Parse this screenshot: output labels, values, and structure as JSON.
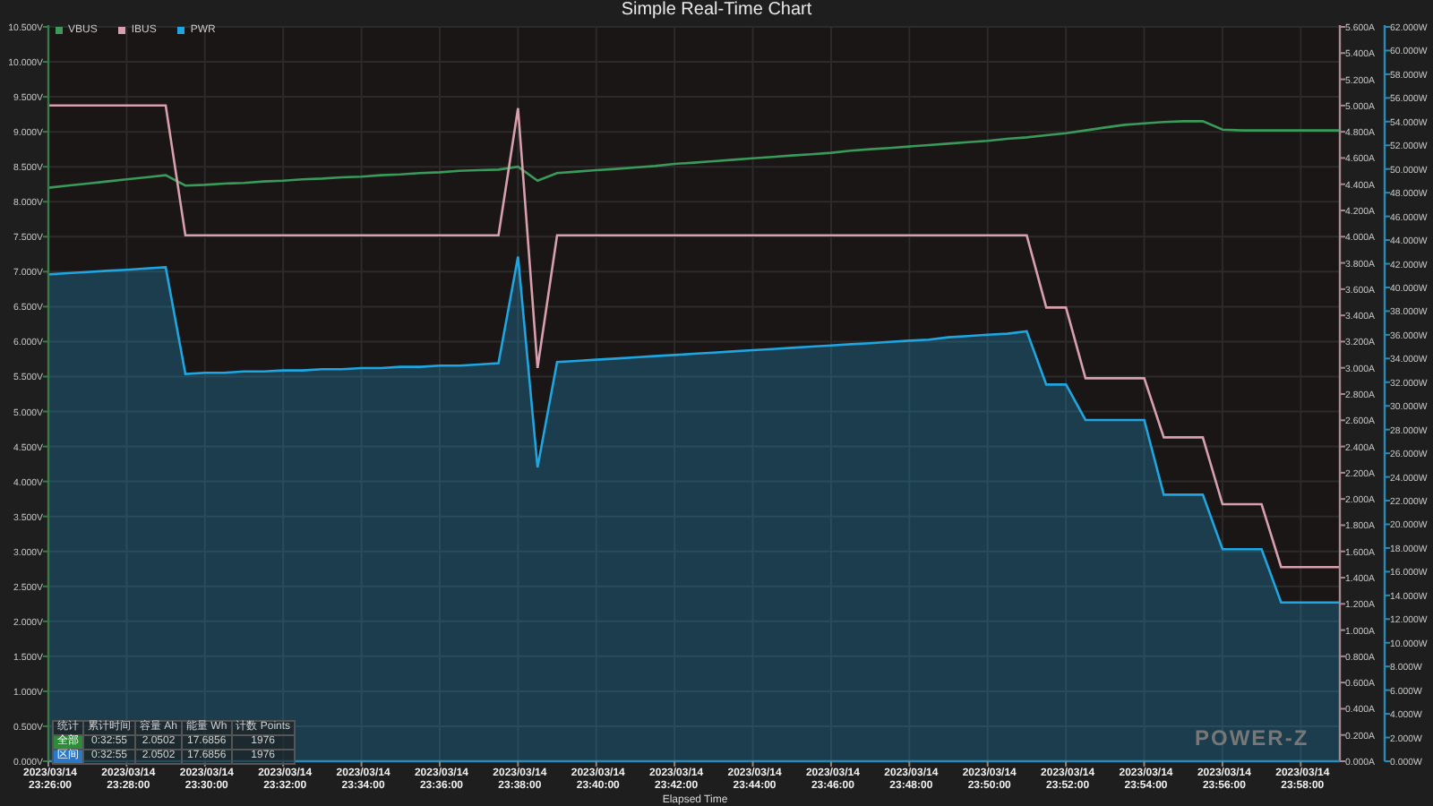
{
  "window": {
    "title": "Simple Real-Time Chart"
  },
  "chart": {
    "chart_data": {
      "type": "line",
      "xlabel": "Elapsed Time",
      "categories": [
        "2023/03/14 23:26:00",
        null,
        null,
        null,
        "2023/03/14 23:28:00",
        null,
        null,
        null,
        "2023/03/14 23:30:00",
        null,
        null,
        null,
        "2023/03/14 23:32:00",
        null,
        null,
        null,
        "2023/03/14 23:34:00",
        null,
        null,
        null,
        "2023/03/14 23:36:00",
        null,
        null,
        null,
        "2023/03/14 23:38:00",
        null,
        null,
        null,
        "2023/03/14 23:40:00",
        null,
        null,
        null,
        "2023/03/14 23:42:00",
        null,
        null,
        null,
        "2023/03/14 23:44:00",
        null,
        null,
        null,
        "2023/03/14 23:46:00",
        null,
        null,
        null,
        "2023/03/14 23:48:00",
        null,
        null,
        null,
        "2023/03/14 23:50:00",
        null,
        null,
        null,
        "2023/03/14 23:52:00",
        null,
        null,
        null,
        "2023/03/14 23:54:00",
        null,
        null,
        null,
        "2023/03/14 23:56:00",
        null,
        null,
        null,
        "2023/03/14 23:58:00",
        null,
        null
      ],
      "series": [
        {
          "name": "VBUS",
          "color": "#3a9a5a",
          "type": "line",
          "values": [
            8.2,
            8.23,
            8.26,
            8.29,
            8.32,
            8.35,
            8.38,
            8.23,
            8.24,
            8.26,
            8.27,
            8.29,
            8.3,
            8.32,
            8.33,
            8.35,
            8.36,
            8.38,
            8.39,
            8.41,
            8.42,
            8.44,
            8.45,
            8.46,
            8.5,
            8.3,
            8.41,
            8.43,
            8.45,
            8.47,
            8.49,
            8.51,
            8.54,
            8.56,
            8.58,
            8.6,
            8.62,
            8.64,
            8.66,
            8.68,
            8.7,
            8.73,
            8.75,
            8.77,
            8.79,
            8.81,
            8.83,
            8.85,
            8.87,
            8.9,
            8.92,
            8.95,
            8.98,
            9.02,
            9.06,
            9.1,
            9.12,
            9.14,
            9.15,
            9.15,
            9.03,
            9.02,
            9.02,
            9.02,
            9.02,
            9.02,
            9.02
          ]
        },
        {
          "name": "IBUS",
          "color": "#d8a0ac",
          "axis": "y2",
          "type": "line",
          "values": [
            5.0,
            5.0,
            5.0,
            5.0,
            5.0,
            5.0,
            5.0,
            4.01,
            4.01,
            4.01,
            4.01,
            4.01,
            4.01,
            4.01,
            4.01,
            4.01,
            4.01,
            4.01,
            4.01,
            4.01,
            4.01,
            4.01,
            4.01,
            4.01,
            4.98,
            3.0,
            4.01,
            4.01,
            4.01,
            4.01,
            4.01,
            4.01,
            4.01,
            4.01,
            4.01,
            4.01,
            4.01,
            4.01,
            4.01,
            4.01,
            4.01,
            4.01,
            4.01,
            4.01,
            4.01,
            4.01,
            4.01,
            4.01,
            4.01,
            4.01,
            4.01,
            3.46,
            3.46,
            2.92,
            2.92,
            2.92,
            2.92,
            2.47,
            2.47,
            2.47,
            1.96,
            1.96,
            1.96,
            1.48,
            1.48,
            1.48,
            1.48
          ]
        },
        {
          "name": "PWR",
          "color": "#1fa6e0",
          "axis": "y3",
          "type": "area",
          "values": [
            41.1,
            41.2,
            41.3,
            41.4,
            41.5,
            41.6,
            41.7,
            32.7,
            32.8,
            32.8,
            32.9,
            32.9,
            33.0,
            33.0,
            33.1,
            33.1,
            33.2,
            33.2,
            33.3,
            33.3,
            33.4,
            33.4,
            33.5,
            33.6,
            42.6,
            24.8,
            33.7,
            33.8,
            33.9,
            34.0,
            34.1,
            34.2,
            34.3,
            34.4,
            34.5,
            34.6,
            34.7,
            34.8,
            34.9,
            35.0,
            35.1,
            35.2,
            35.3,
            35.4,
            35.5,
            35.6,
            35.8,
            35.9,
            36.0,
            36.1,
            36.3,
            31.8,
            31.8,
            28.8,
            28.8,
            28.8,
            28.8,
            22.5,
            22.5,
            22.5,
            17.9,
            17.9,
            17.9,
            13.4,
            13.4,
            13.4,
            13.4
          ]
        }
      ],
      "ylim": [
        0,
        10.5
      ],
      "yticks": [
        {
          "value": 0,
          "label": "0.000V"
        },
        {
          "value": 0.5,
          "label": "0.500V"
        },
        {
          "value": 1,
          "label": "1.000V"
        },
        {
          "value": 1.5,
          "label": "1.500V"
        },
        {
          "value": 2,
          "label": "2.000V"
        },
        {
          "value": 2.5,
          "label": "2.500V"
        },
        {
          "value": 3,
          "label": "3.000V"
        },
        {
          "value": 3.5,
          "label": "3.500V"
        },
        {
          "value": 4,
          "label": "4.000V"
        },
        {
          "value": 4.5,
          "label": "4.500V"
        },
        {
          "value": 5,
          "label": "5.000V"
        },
        {
          "value": 5.5,
          "label": "5.500V"
        },
        {
          "value": 6,
          "label": "6.000V"
        },
        {
          "value": 6.5,
          "label": "6.500V"
        },
        {
          "value": 7,
          "label": "7.000V"
        },
        {
          "value": 7.5,
          "label": "7.500V"
        },
        {
          "value": 8,
          "label": "8.000V"
        },
        {
          "value": 8.5,
          "label": "8.500V"
        },
        {
          "value": 9,
          "label": "9.000V"
        },
        {
          "value": 9.5,
          "label": "9.500V"
        },
        {
          "value": 10,
          "label": "10.000V"
        },
        {
          "value": 10.5,
          "label": "10.500V"
        }
      ],
      "y2lim": [
        0,
        5.6
      ],
      "y2ticks": [
        {
          "value": 0,
          "label": "0.000A"
        },
        {
          "value": 0.2,
          "label": "0.200A"
        },
        {
          "value": 0.4,
          "label": "0.400A"
        },
        {
          "value": 0.6,
          "label": "0.600A"
        },
        {
          "value": 0.8,
          "label": "0.800A"
        },
        {
          "value": 1,
          "label": "1.000A"
        },
        {
          "value": 1.2,
          "label": "1.200A"
        },
        {
          "value": 1.4,
          "label": "1.400A"
        },
        {
          "value": 1.6,
          "label": "1.600A"
        },
        {
          "value": 1.8,
          "label": "1.800A"
        },
        {
          "value": 2,
          "label": "2.000A"
        },
        {
          "value": 2.2,
          "label": "2.200A"
        },
        {
          "value": 2.4,
          "label": "2.400A"
        },
        {
          "value": 2.6,
          "label": "2.600A"
        },
        {
          "value": 2.8,
          "label": "2.800A"
        },
        {
          "value": 3,
          "label": "3.000A"
        },
        {
          "value": 3.2,
          "label": "3.200A"
        },
        {
          "value": 3.4,
          "label": "3.400A"
        },
        {
          "value": 3.6,
          "label": "3.600A"
        },
        {
          "value": 3.8,
          "label": "3.800A"
        },
        {
          "value": 4,
          "label": "4.000A"
        },
        {
          "value": 4.2,
          "label": "4.200A"
        },
        {
          "value": 4.4,
          "label": "4.400A"
        },
        {
          "value": 4.6,
          "label": "4.600A"
        },
        {
          "value": 4.8,
          "label": "4.800A"
        },
        {
          "value": 5,
          "label": "5.000A"
        },
        {
          "value": 5.2,
          "label": "5.200A"
        },
        {
          "value": 5.4,
          "label": "5.400A"
        },
        {
          "value": 5.6,
          "label": "5.600A"
        }
      ],
      "y3lim": [
        0,
        62
      ],
      "y3ticks": [
        {
          "value": 0,
          "label": "0.000W"
        },
        {
          "value": 2,
          "label": "2.000W"
        },
        {
          "value": 4,
          "label": "4.000W"
        },
        {
          "value": 6,
          "label": "6.000W"
        },
        {
          "value": 8,
          "label": "8.000W"
        },
        {
          "value": 10,
          "label": "10.000W"
        },
        {
          "value": 12,
          "label": "12.000W"
        },
        {
          "value": 14,
          "label": "14.000W"
        },
        {
          "value": 16,
          "label": "16.000W"
        },
        {
          "value": 18,
          "label": "18.000W"
        },
        {
          "value": 20,
          "label": "20.000W"
        },
        {
          "value": 22,
          "label": "22.000W"
        },
        {
          "value": 24,
          "label": "24.000W"
        },
        {
          "value": 26,
          "label": "26.000W"
        },
        {
          "value": 28,
          "label": "28.000W"
        },
        {
          "value": 30,
          "label": "30.000W"
        },
        {
          "value": 32,
          "label": "32.000W"
        },
        {
          "value": 34,
          "label": "34.000W"
        },
        {
          "value": 36,
          "label": "36.000W"
        },
        {
          "value": 38,
          "label": "38.000W"
        },
        {
          "value": 40,
          "label": "40.000W"
        },
        {
          "value": 42,
          "label": "42.000W"
        },
        {
          "value": 44,
          "label": "44.000W"
        },
        {
          "value": 46,
          "label": "46.000W"
        },
        {
          "value": 48,
          "label": "48.000W"
        },
        {
          "value": 50,
          "label": "50.000W"
        },
        {
          "value": 52,
          "label": "52.000W"
        },
        {
          "value": 54,
          "label": "54.000W"
        },
        {
          "value": 56,
          "label": "56.000W"
        },
        {
          "value": 58,
          "label": "58.000W"
        },
        {
          "value": 60,
          "label": "60.000W"
        },
        {
          "value": 62,
          "label": "62.000W"
        }
      ],
      "grid": true,
      "legend": "upper left"
    },
    "stats": {
      "columns": [
        "统计",
        "累计时间",
        "容量 Ah",
        "能量 Wh",
        "计数 Points"
      ],
      "rows": [
        {
          "color": "#2e8b3a",
          "cells": [
            "全部",
            "0:32:55",
            "2.0502",
            "17.6856",
            "1976"
          ]
        },
        {
          "color": "#2a78c8",
          "cells": [
            "区间",
            "0:32:55",
            "2.0502",
            "17.6856",
            "1976"
          ]
        }
      ]
    },
    "logo": "POWER-Z"
  }
}
